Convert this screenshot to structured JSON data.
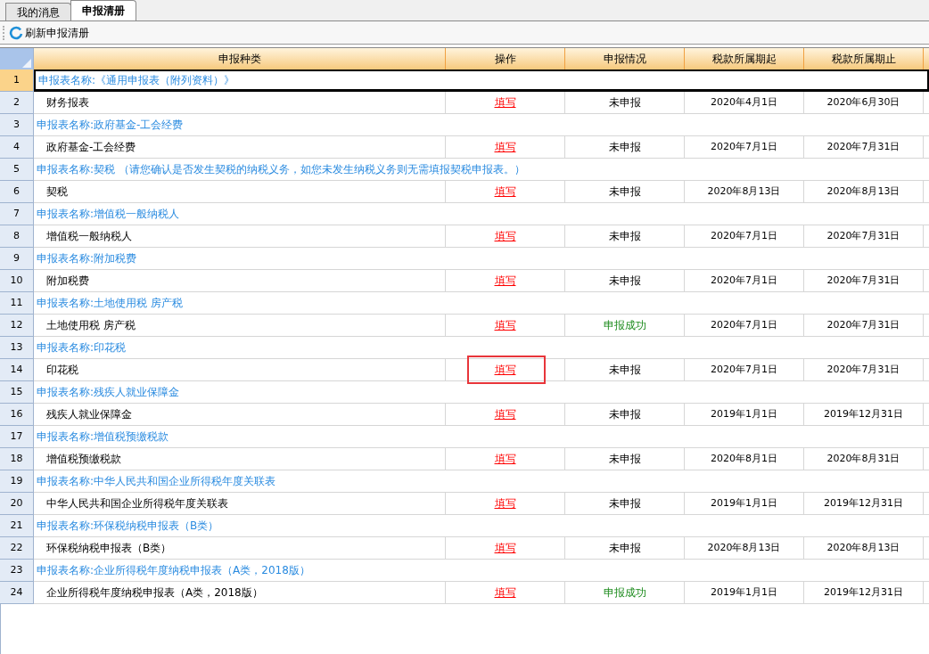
{
  "tabs": [
    {
      "label": "我的消息",
      "selected": false
    },
    {
      "label": "申报清册",
      "selected": true
    }
  ],
  "toolbar": {
    "refresh_button": "刷新申报清册"
  },
  "table": {
    "columns": [
      "申报种类",
      "操作",
      "申报情况",
      "税款所属期起",
      "税款所属期止"
    ],
    "rows": [
      {
        "kind": "group",
        "number": "1",
        "title": "申报表名称:《通用申报表（附列资料）》",
        "selected": true
      },
      {
        "kind": "item",
        "number": "2",
        "name": "财务报表",
        "action": "填写",
        "status": "未申报",
        "done": false,
        "start": "2020年4月1日",
        "end": "2020年6月30日",
        "selected": false,
        "highlighted": false
      },
      {
        "kind": "group",
        "number": "3",
        "title": "申报表名称:政府基金-工会经费",
        "selected": false
      },
      {
        "kind": "item",
        "number": "4",
        "name": "政府基金-工会经费",
        "action": "填写",
        "status": "未申报",
        "done": false,
        "start": "2020年7月1日",
        "end": "2020年7月31日",
        "selected": false,
        "highlighted": false
      },
      {
        "kind": "group",
        "number": "5",
        "title": "申报表名称:契税 （请您确认是否发生契税的纳税义务，如您未发生纳税义务则无需填报契税申报表。）",
        "selected": false
      },
      {
        "kind": "item",
        "number": "6",
        "name": "契税",
        "action": "填写",
        "status": "未申报",
        "done": false,
        "start": "2020年8月13日",
        "end": "2020年8月13日",
        "selected": false,
        "highlighted": false
      },
      {
        "kind": "group",
        "number": "7",
        "title": "申报表名称:增值税一般纳税人",
        "selected": false
      },
      {
        "kind": "item",
        "number": "8",
        "name": "增值税一般纳税人",
        "action": "填写",
        "status": "未申报",
        "done": false,
        "start": "2020年7月1日",
        "end": "2020年7月31日",
        "selected": false,
        "highlighted": false
      },
      {
        "kind": "group",
        "number": "9",
        "title": "申报表名称:附加税费",
        "selected": false
      },
      {
        "kind": "item",
        "number": "10",
        "name": "附加税费",
        "action": "填写",
        "status": "未申报",
        "done": false,
        "start": "2020年7月1日",
        "end": "2020年7月31日",
        "selected": false,
        "highlighted": false
      },
      {
        "kind": "group",
        "number": "11",
        "title": "申报表名称:土地使用税 房产税",
        "selected": false
      },
      {
        "kind": "item",
        "number": "12",
        "name": "土地使用税 房产税",
        "action": "填写",
        "status": "申报成功",
        "done": true,
        "start": "2020年7月1日",
        "end": "2020年7月31日",
        "selected": false,
        "highlighted": false
      },
      {
        "kind": "group",
        "number": "13",
        "title": "申报表名称:印花税",
        "selected": false
      },
      {
        "kind": "item",
        "number": "14",
        "name": "印花税",
        "action": "填写",
        "status": "未申报",
        "done": false,
        "start": "2020年7月1日",
        "end": "2020年7月31日",
        "selected": false,
        "highlighted": true
      },
      {
        "kind": "group",
        "number": "15",
        "title": "申报表名称:残疾人就业保障金",
        "selected": false
      },
      {
        "kind": "item",
        "number": "16",
        "name": "残疾人就业保障金",
        "action": "填写",
        "status": "未申报",
        "done": false,
        "start": "2019年1月1日",
        "end": "2019年12月31日",
        "selected": false,
        "highlighted": false
      },
      {
        "kind": "group",
        "number": "17",
        "title": "申报表名称:增值税预缴税款",
        "selected": false
      },
      {
        "kind": "item",
        "number": "18",
        "name": "增值税预缴税款",
        "action": "填写",
        "status": "未申报",
        "done": false,
        "start": "2020年8月1日",
        "end": "2020年8月31日",
        "selected": false,
        "highlighted": false
      },
      {
        "kind": "group",
        "number": "19",
        "title": "申报表名称:中华人民共和国企业所得税年度关联表",
        "selected": false
      },
      {
        "kind": "item",
        "number": "20",
        "name": "中华人民共和国企业所得税年度关联表",
        "action": "填写",
        "status": "未申报",
        "done": false,
        "start": "2019年1月1日",
        "end": "2019年12月31日",
        "selected": false,
        "highlighted": false
      },
      {
        "kind": "group",
        "number": "21",
        "title": "申报表名称:环保税纳税申报表（B类）",
        "selected": false
      },
      {
        "kind": "item",
        "number": "22",
        "name": "环保税纳税申报表（B类）",
        "action": "填写",
        "status": "未申报",
        "done": false,
        "start": "2020年8月13日",
        "end": "2020年8月13日",
        "selected": false,
        "highlighted": false
      },
      {
        "kind": "group",
        "number": "23",
        "title": "申报表名称:企业所得税年度纳税申报表（A类，2018版）",
        "selected": false
      },
      {
        "kind": "item",
        "number": "24",
        "name": "企业所得税年度纳税申报表（A类，2018版）",
        "action": "填写",
        "status": "申报成功",
        "done": true,
        "start": "2019年1月1日",
        "end": "2019年12月31日",
        "selected": false,
        "highlighted": false
      }
    ]
  }
}
